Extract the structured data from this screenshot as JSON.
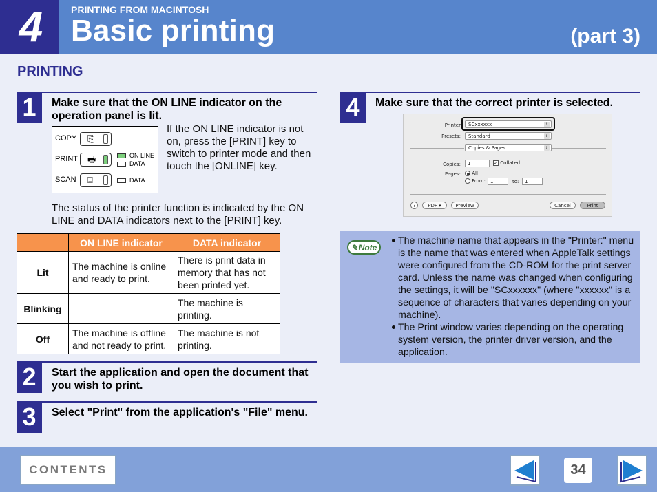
{
  "header": {
    "chapter_number": "4",
    "kicker": "PRINTING FROM MACINTOSH",
    "title": "Basic printing",
    "part": "(part 3)"
  },
  "section_title": "PRINTING",
  "steps": [
    {
      "number": "1",
      "text": "Make sure that the ON LINE indicator on the operation panel is lit.",
      "side_text": "If the ON LINE indicator is not on, press the [PRINT] key to switch to printer mode and then touch the [ONLINE] key.",
      "panel": {
        "rows": [
          {
            "label": "COPY",
            "icon": "copy-icon",
            "glyph": "⎘",
            "led_on": false
          },
          {
            "label": "PRINT",
            "icon": "printer-icon",
            "glyph": "🖶",
            "led_on": true
          },
          {
            "label": "SCAN",
            "icon": "scanner-icon",
            "glyph": "⌸",
            "led_on": false
          }
        ],
        "indicators": [
          {
            "label": "ON LINE",
            "lit": true
          },
          {
            "label": "DATA",
            "lit": false
          },
          {
            "label": "DATA",
            "lit": false
          }
        ]
      },
      "status_text": "The status of the printer function is indicated by the ON LINE and DATA indicators next to the [PRINT] key."
    },
    {
      "number": "2",
      "text": "Start the application and open the document that you wish to print."
    },
    {
      "number": "3",
      "text": "Select \"Print\" from the application's \"File\" menu."
    },
    {
      "number": "4",
      "text": "Make sure that the correct printer is selected."
    }
  ],
  "status_table": {
    "headers": [
      "",
      "ON LINE indicator",
      "DATA indicator"
    ],
    "rows": [
      {
        "state": "Lit",
        "online": "The machine is online and ready to print.",
        "data": "There is print data in memory that has not been printed yet."
      },
      {
        "state": "Blinking",
        "online": "—",
        "data": "The machine is printing."
      },
      {
        "state": "Off",
        "online": "The machine is offline and not ready to print.",
        "data": "The machine is not printing."
      }
    ]
  },
  "print_dialog": {
    "printer_label": "Printer",
    "printer_value": "SCxxxxxx",
    "presets_label": "Presets:",
    "presets_value": "Standard",
    "panel_value": "Copies & Pages",
    "copies_label": "Copies:",
    "copies_value": "1",
    "collated_label": "Collated",
    "collated_checked": true,
    "pages_label": "Pages:",
    "all_label": "All",
    "from_label": "From:",
    "from_value": "1",
    "to_label": "to:",
    "to_value": "1",
    "help_label": "?",
    "pdf_label": "PDF ▾",
    "preview_label": "Preview",
    "cancel_label": "Cancel",
    "print_label": "Print"
  },
  "note": {
    "badge": "Note",
    "items": [
      "The machine name that appears in the \"Printer:\" menu is the name that was entered when AppleTalk settings were configured from the CD-ROM for the print server card. Unless the name was changed when configuring the settings, it will be \"SCxxxxxx\" (where \"xxxxxx\" is a sequence of characters that varies depending on your machine).",
      "The Print window varies depending on the operating system version, the printer driver version, and the application."
    ]
  },
  "footer": {
    "contents_label": "CONTENTS",
    "page_number": "34"
  },
  "colors": {
    "header_blue": "#5785cc",
    "chapter_navy": "#2e2e91",
    "table_header_orange": "#f7934c",
    "note_bg": "#a6b6e4",
    "footer_blue": "#82a1d9"
  }
}
